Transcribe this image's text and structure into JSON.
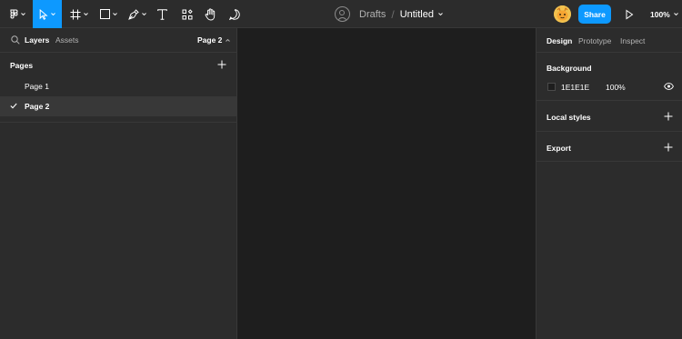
{
  "toolbar": {
    "breadcrumb_folder": "Drafts",
    "breadcrumb_sep": "/",
    "file_title": "Untitled",
    "share_label": "Share",
    "zoom_label": "100%",
    "accent_color": "#0d99ff"
  },
  "left_panel": {
    "tab_layers": "Layers",
    "tab_assets": "Assets",
    "current_page": "Page 2",
    "pages_heading": "Pages",
    "pages": [
      {
        "name": "Page 1",
        "selected": false
      },
      {
        "name": "Page 2",
        "selected": true
      }
    ]
  },
  "right_panel": {
    "tab_design": "Design",
    "tab_prototype": "Prototype",
    "tab_inspect": "Inspect",
    "background_heading": "Background",
    "background_hex": "1E1E1E",
    "background_opacity": "100%",
    "local_styles_heading": "Local styles",
    "export_heading": "Export"
  },
  "icons": [
    "figma-menu-icon",
    "move-tool-icon",
    "frame-tool-icon",
    "shape-tool-icon",
    "pen-tool-icon",
    "text-tool-icon",
    "resources-icon",
    "hand-tool-icon",
    "comment-tool-icon",
    "user-icon",
    "avatar-icon",
    "play-icon",
    "search-icon",
    "plus-icon",
    "checkmark-icon",
    "eye-icon"
  ]
}
